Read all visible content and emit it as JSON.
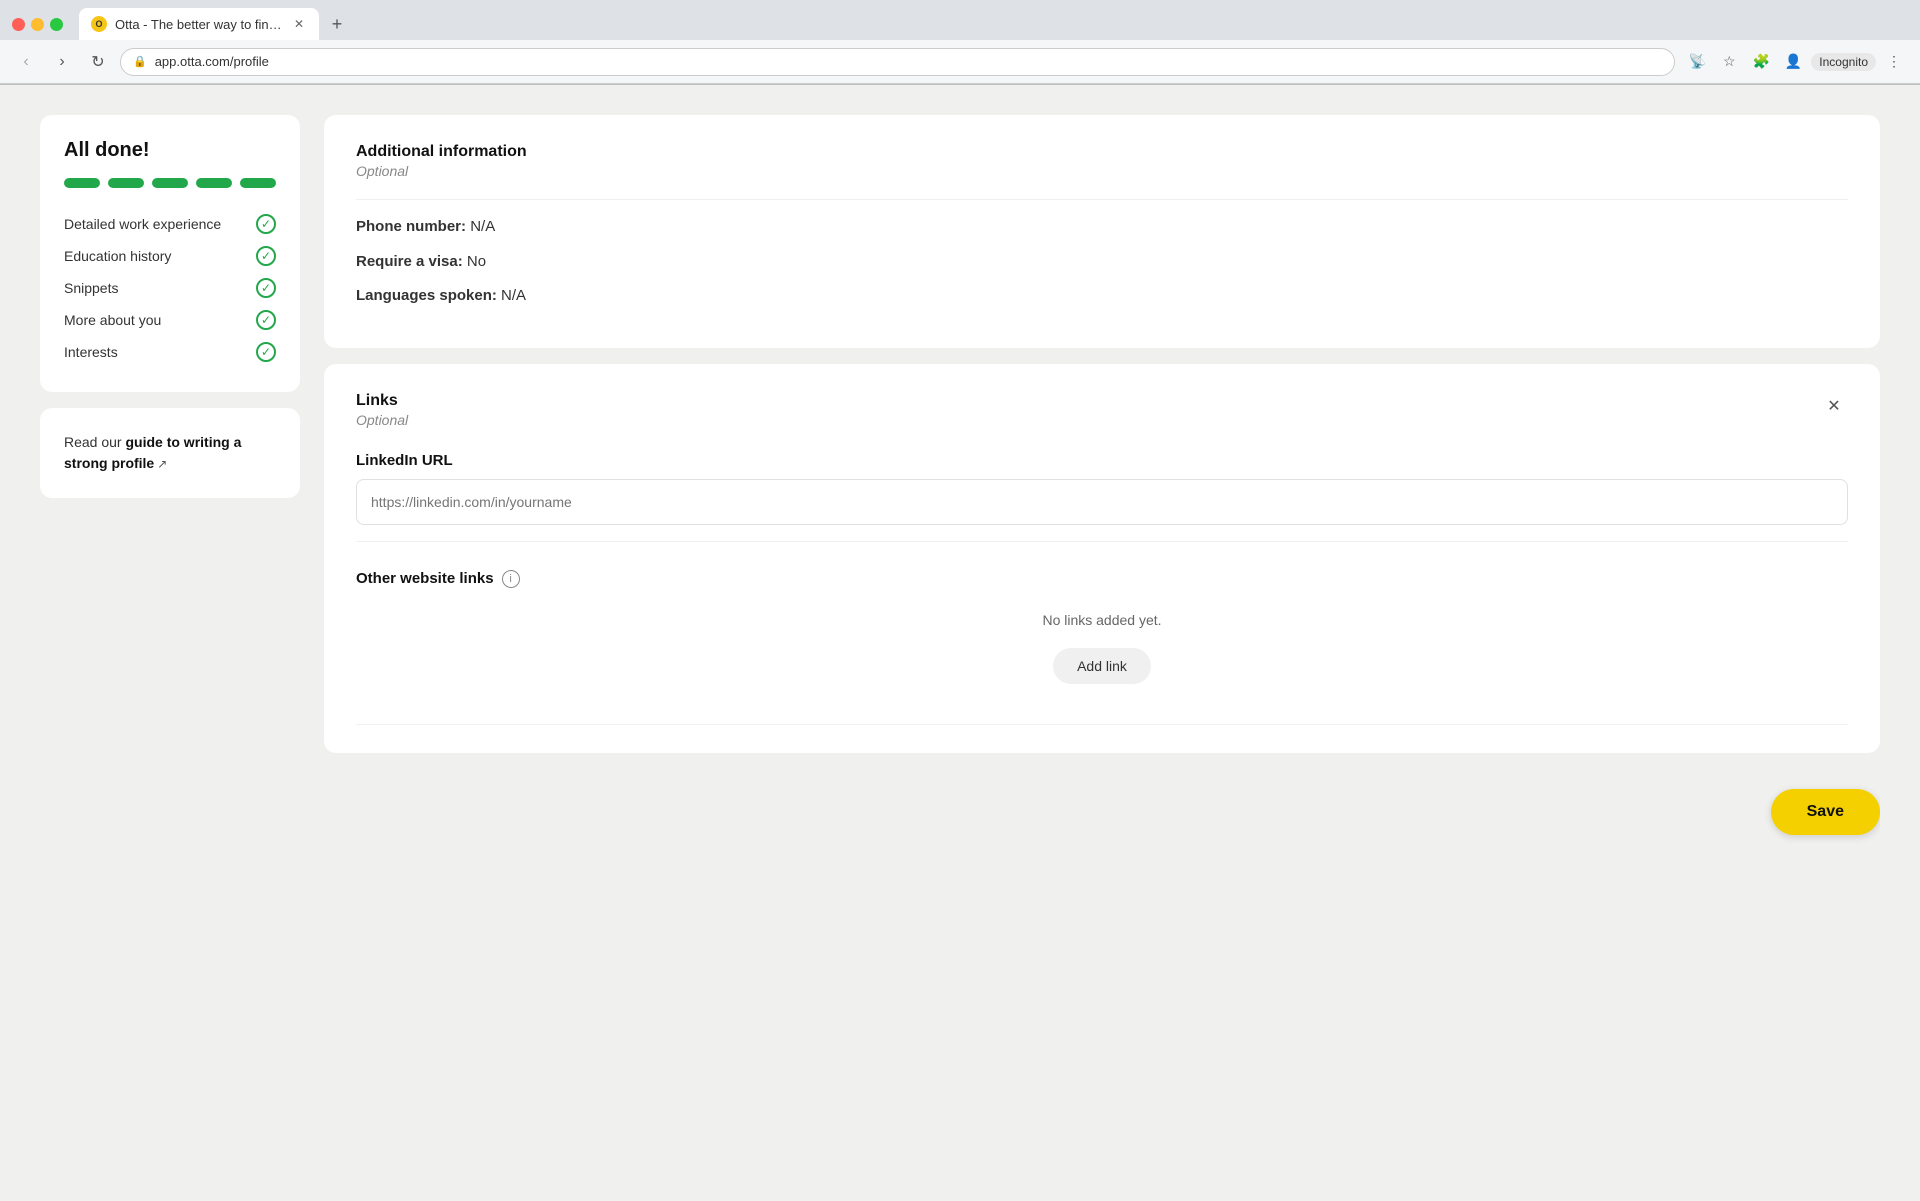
{
  "browser": {
    "tab_title": "Otta - The better way to find a",
    "favicon_text": "O",
    "url": "app.otta.com/profile",
    "incognito_label": "Incognito"
  },
  "sidebar": {
    "all_done_title": "All done!",
    "progress_bars_count": 5,
    "checklist": [
      {
        "label": "Detailed work experience"
      },
      {
        "label": "Education history"
      },
      {
        "label": "Snippets"
      },
      {
        "label": "More about you"
      },
      {
        "label": "Interests"
      }
    ],
    "guide_prefix": "Read our ",
    "guide_link_text": "guide to writing a strong profile",
    "guide_suffix": ""
  },
  "additional_info": {
    "section_title": "Additional information",
    "section_subtitle": "Optional",
    "phone_label": "Phone number:",
    "phone_value": "N/A",
    "visa_label": "Require a visa:",
    "visa_value": "No",
    "languages_label": "Languages spoken:",
    "languages_value": "N/A"
  },
  "links": {
    "section_title": "Links",
    "section_subtitle": "Optional",
    "linkedin_label": "LinkedIn URL",
    "linkedin_placeholder": "https://linkedin.com/in/yourname",
    "other_links_label": "Other website links",
    "no_links_text": "No links added yet.",
    "add_link_btn": "Add link"
  },
  "save": {
    "label": "Save"
  }
}
